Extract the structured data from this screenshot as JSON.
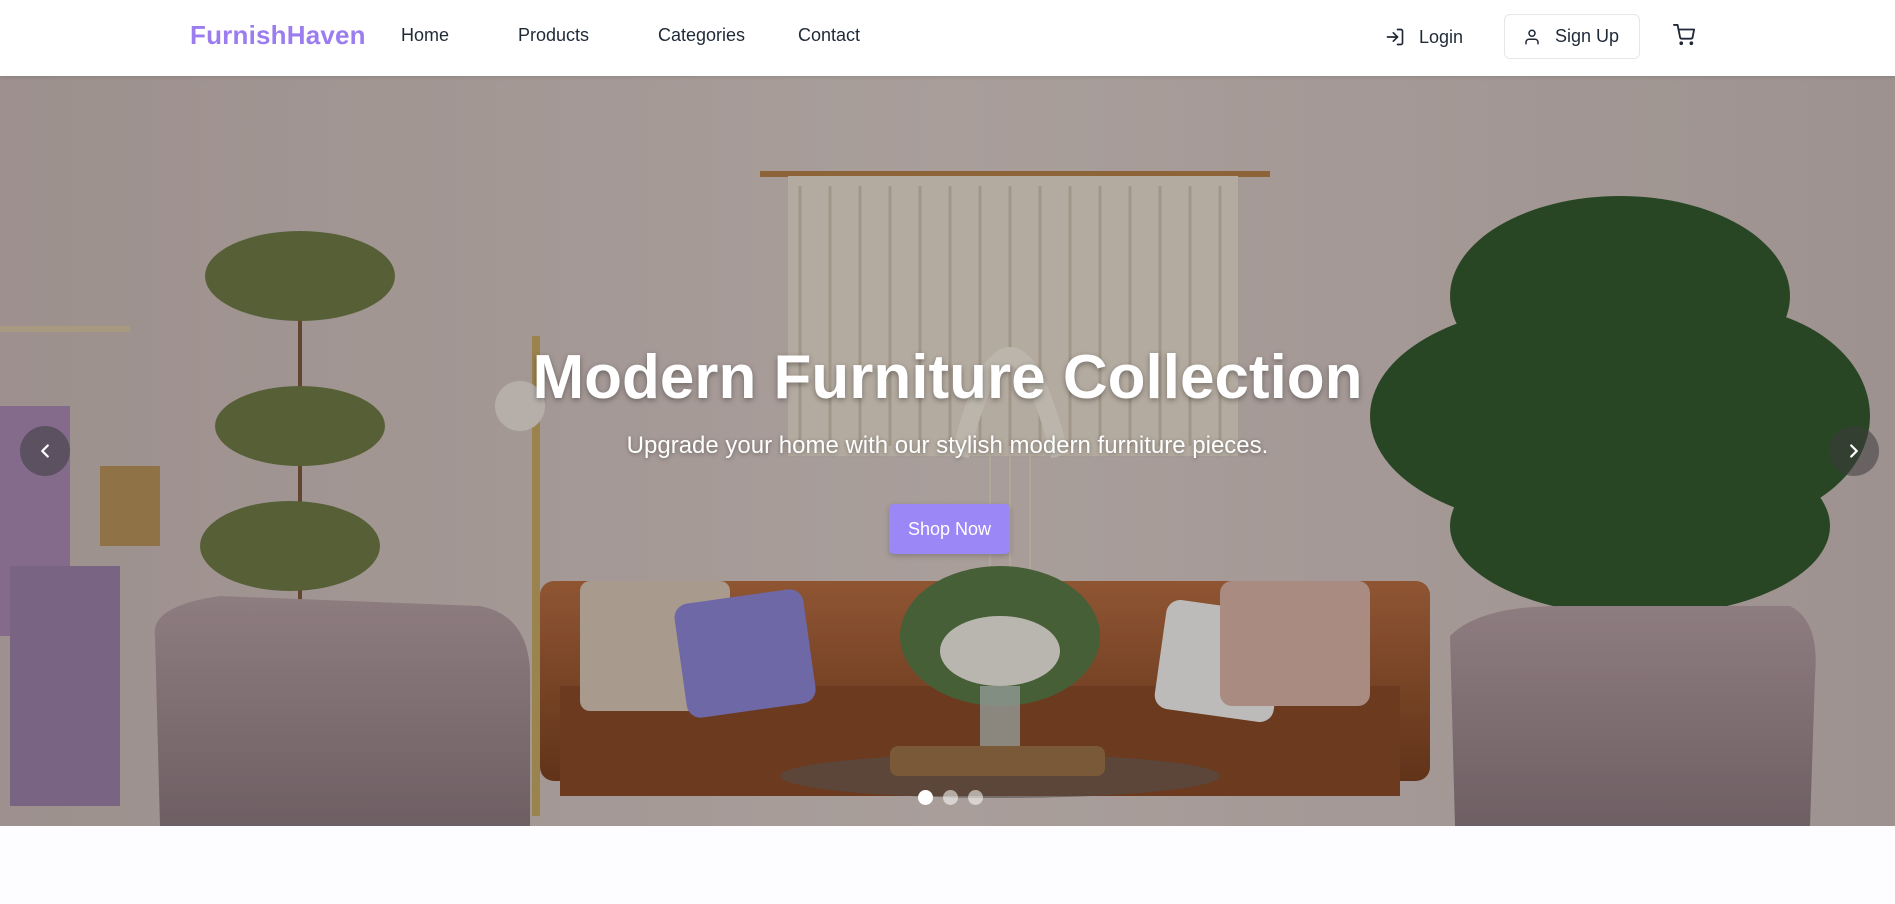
{
  "brand": {
    "name": "FurnishHaven",
    "color": "#9b7df0"
  },
  "nav": {
    "items": [
      {
        "label": "Home"
      },
      {
        "label": "Products"
      },
      {
        "label": "Categories"
      },
      {
        "label": "Contact"
      }
    ]
  },
  "auth": {
    "login_label": "Login",
    "login_icon": "log-in-icon",
    "signup_label": "Sign Up",
    "signup_icon": "user-icon"
  },
  "cart": {
    "icon": "shopping-cart-icon"
  },
  "hero": {
    "title": "Modern Furniture Collection",
    "subtitle": "Upgrade your home with our stylish modern furniture pieces.",
    "cta_label": "Shop Now",
    "cta_color": "#9b87f5",
    "prev_icon": "chevron-left-icon",
    "next_icon": "chevron-right-icon",
    "slide_count": 3,
    "active_slide": 1
  }
}
